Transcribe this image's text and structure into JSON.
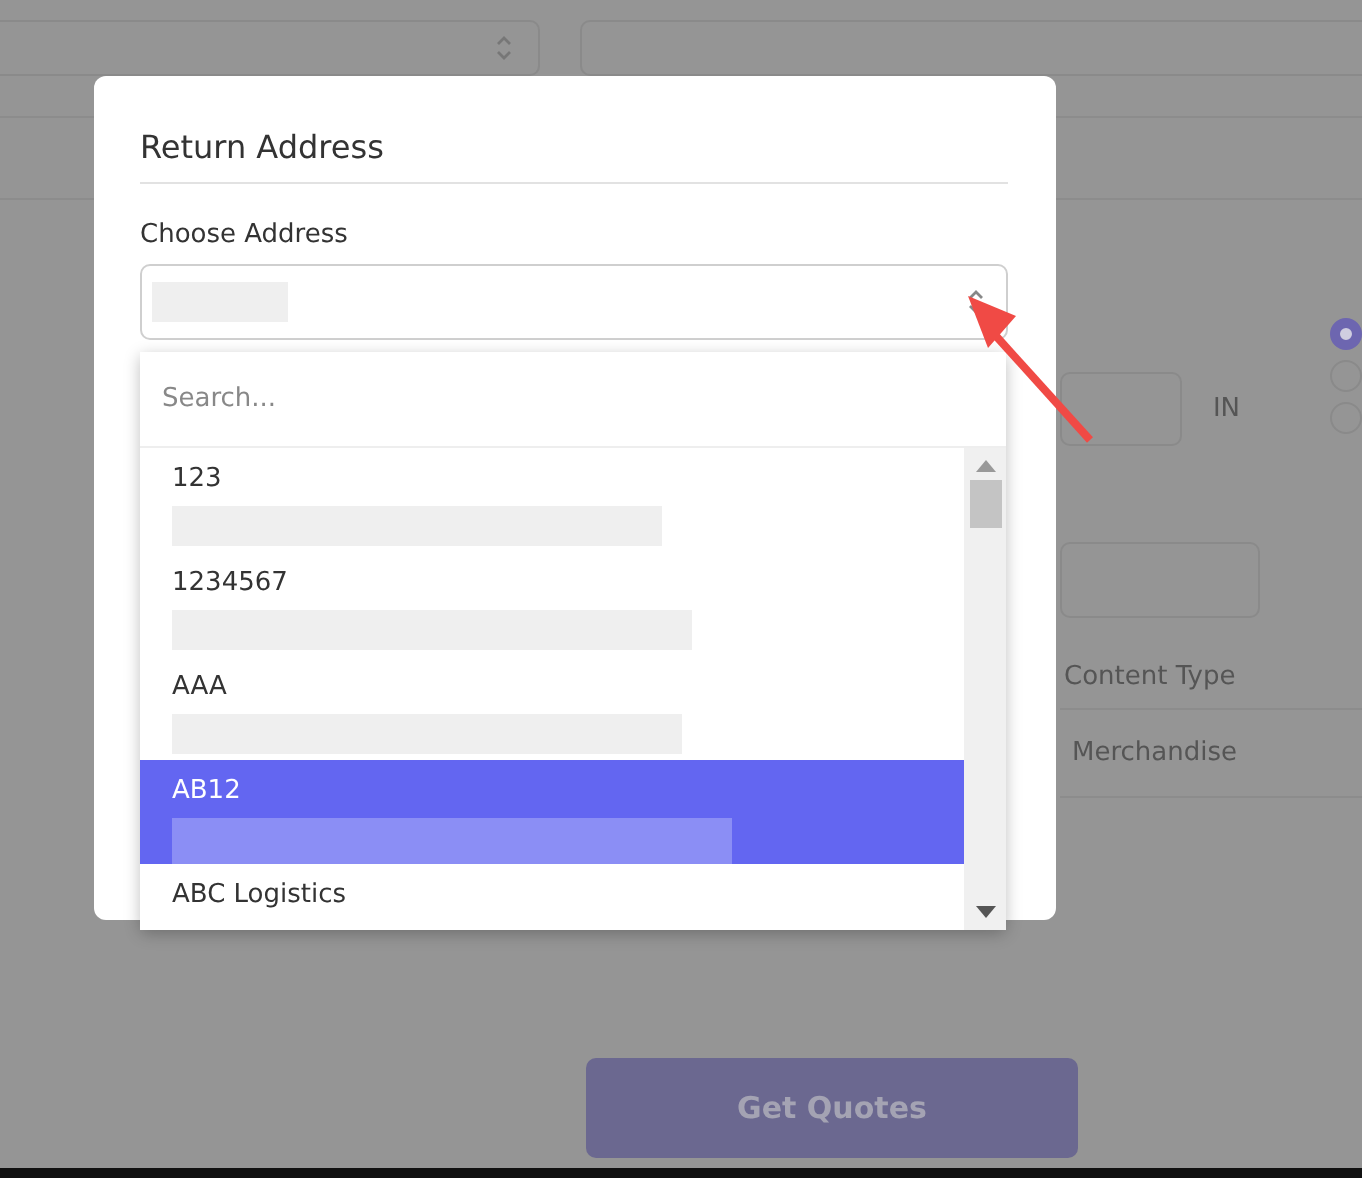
{
  "background": {
    "radio_options": [
      {
        "selected": true
      },
      {
        "selected": false
      },
      {
        "selected": false
      }
    ],
    "unit": "IN",
    "content_type_label": "Content Type",
    "content_type_value": "Merchandise",
    "submit_button": "Get Quotes"
  },
  "dialog": {
    "title": "Return Address",
    "field_label": "Choose Address",
    "dropdown": {
      "search_placeholder": "Search...",
      "options": [
        {
          "name": "123",
          "selected": false
        },
        {
          "name": "1234567",
          "selected": false
        },
        {
          "name": "AAA",
          "selected": false
        },
        {
          "name": "AB12",
          "selected": true
        },
        {
          "name": "ABC Logistics",
          "selected": false
        }
      ]
    }
  }
}
